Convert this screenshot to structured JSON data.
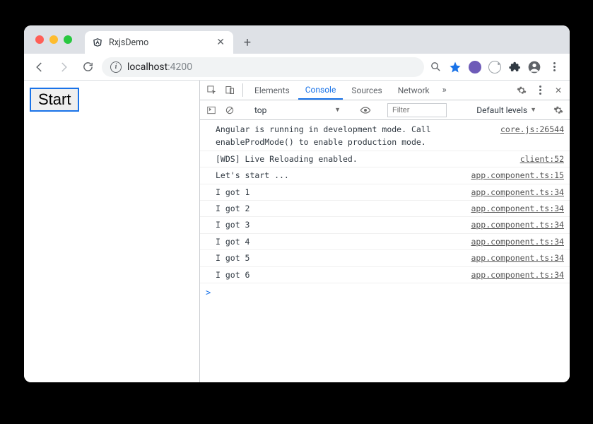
{
  "tab": {
    "title": "RxjsDemo"
  },
  "url": {
    "host": "localhost",
    "port": ":4200"
  },
  "page": {
    "start_label": "Start"
  },
  "devtools": {
    "tabs": {
      "elements": "Elements",
      "console": "Console",
      "sources": "Sources",
      "network": "Network"
    },
    "toolbar": {
      "context": "top",
      "filter_placeholder": "Filter",
      "levels": "Default levels"
    },
    "logs": [
      {
        "msg": "Angular is running in development mode. Call enableProdMode() to enable production mode.",
        "src": "core.js:26544"
      },
      {
        "msg": "[WDS] Live Reloading enabled.",
        "src": "client:52"
      },
      {
        "msg": "Let's start ...",
        "src": "app.component.ts:15"
      },
      {
        "msg": "I got 1",
        "src": "app.component.ts:34"
      },
      {
        "msg": "I got 2",
        "src": "app.component.ts:34"
      },
      {
        "msg": "I got 3",
        "src": "app.component.ts:34"
      },
      {
        "msg": "I got 4",
        "src": "app.component.ts:34"
      },
      {
        "msg": "I got 5",
        "src": "app.component.ts:34"
      },
      {
        "msg": "I got 6",
        "src": "app.component.ts:34"
      }
    ],
    "prompt": ">"
  }
}
